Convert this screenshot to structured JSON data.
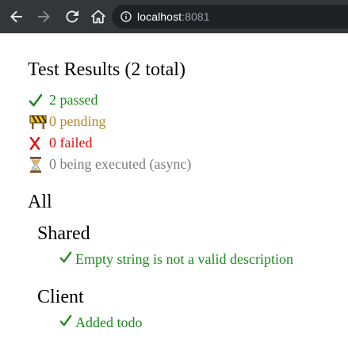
{
  "browser": {
    "url_host": "localhost",
    "url_port": ":8081"
  },
  "results": {
    "title": "Test Results (2 total)",
    "passed": "2 passed",
    "pending": "0 pending",
    "failed": "0 failed",
    "executing": "0 being executed (async)"
  },
  "suites": {
    "root_label": "All",
    "groups": [
      {
        "name": "Shared",
        "tests": [
          "Empty string is not a valid description"
        ]
      },
      {
        "name": "Client",
        "tests": [
          "Added todo"
        ]
      }
    ]
  },
  "colors": {
    "passed": "#1b8a1b",
    "pending": "#b8862c",
    "failed": "#e01010",
    "executing": "#7a7a7a"
  },
  "icons": {
    "passed": "check-icon",
    "pending": "construction-barrier-icon",
    "failed": "cross-icon",
    "executing": "hourglass-icon"
  }
}
